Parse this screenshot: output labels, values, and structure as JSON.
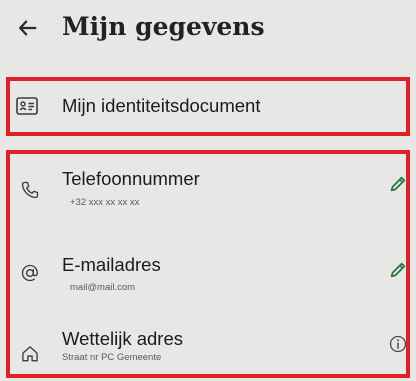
{
  "header": {
    "back_icon": "arrow-left-icon",
    "title": "Mijn gegevens"
  },
  "identity": {
    "icon": "id-card-icon",
    "label": "Mijn identiteitsdocument"
  },
  "contact_items": [
    {
      "icon": "phone-icon",
      "label": "Telefoonnummer",
      "value": "+32 xxx xx xx xx",
      "action_icon": "pencil-icon"
    },
    {
      "icon": "at-sign-icon",
      "label": "E-mailadres",
      "value": "mail@mail.com",
      "action_icon": "pencil-icon"
    },
    {
      "icon": "home-icon",
      "label": "Wettelijk adres",
      "value": "Straat nr PC Gemeente",
      "action_icon": "info-icon"
    }
  ],
  "colors": {
    "highlight": "#e11f26",
    "edit_icon": "#1e7a3c",
    "background": "#e7e8e6"
  }
}
